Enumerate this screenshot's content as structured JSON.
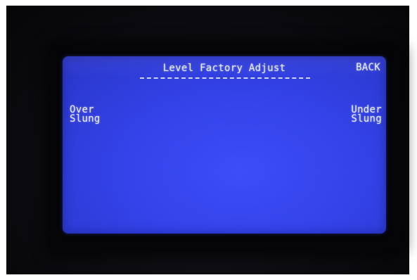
{
  "screen": {
    "title": "Level Factory Adjust",
    "back_label": "BACK",
    "left_option": {
      "line1": "Over",
      "line2": "Slung"
    },
    "right_option": {
      "line1": "Under",
      "line2": "Slung"
    }
  },
  "colors": {
    "lcd_background": "#3443ea",
    "lcd_text": "#e9ecff",
    "bezel": "#0a0a0e"
  }
}
